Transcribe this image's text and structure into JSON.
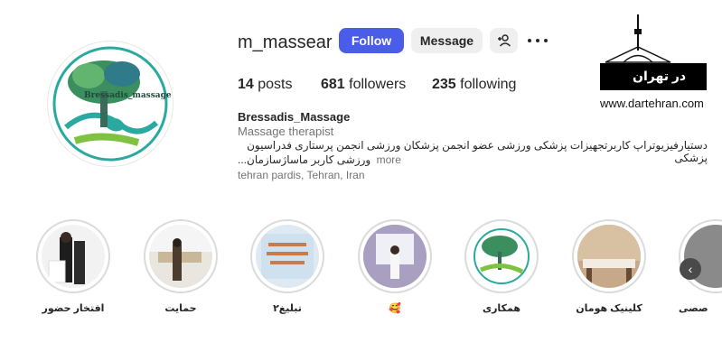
{
  "profile": {
    "username": "m_massear",
    "follow_label": "Follow",
    "message_label": "Message",
    "posts_count": "14",
    "posts_label": "posts",
    "followers_count": "681",
    "followers_label": "followers",
    "following_count": "235",
    "following_label": "following",
    "display_name": "Bressadis_Massage",
    "category": "Massage therapist",
    "bio_line1": "دستیارفیزیوتراپ کاربرتجهیزات پزشکی ورزشی عضو انجمن پزشکان ورزشی انجمن پرستاری فدراسیون پزشکی",
    "bio_line2": "ورزشی کاربر ماساژسازمان...",
    "more_label": "more",
    "location": "tehran pardis, Tehran, Iran",
    "avatar_text": "Bressadis_massage"
  },
  "watermark": {
    "text": "www.dartehran.com",
    "logo_text": "در تهران"
  },
  "stories": [
    {
      "label": "افتخار حضور"
    },
    {
      "label": "حمایت"
    },
    {
      "label": "تبلیغ۲"
    },
    {
      "label": "🥰"
    },
    {
      "label": "همکاری"
    },
    {
      "label": "کلینیک هومان"
    },
    {
      "label": "صصی"
    }
  ],
  "colors": {
    "primary_button": "#4a5de8",
    "secondary_button": "#efefef",
    "muted_text": "#737373",
    "story_ring": "#dbdbdb"
  }
}
